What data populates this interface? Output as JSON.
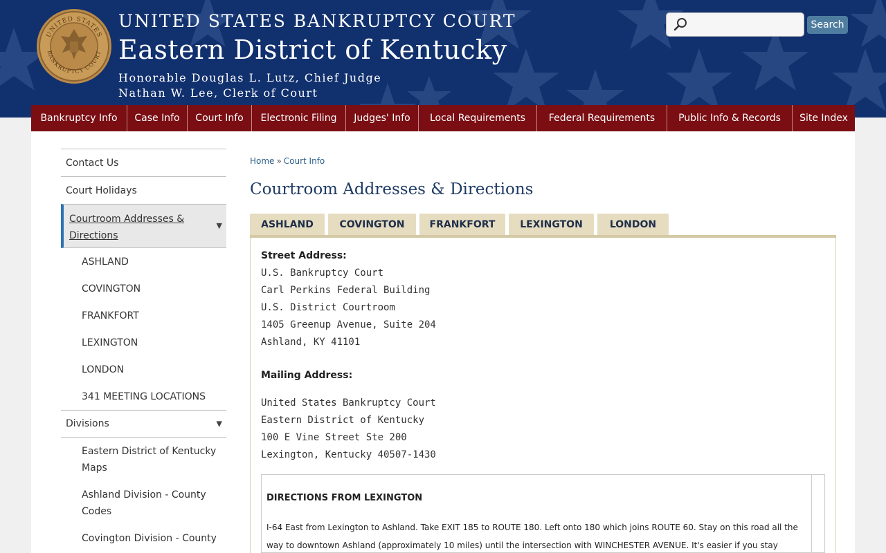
{
  "header": {
    "title_top": "UNITED STATES BANKRUPTCY COURT",
    "title_main": "Eastern District of Kentucky",
    "judge": "Honorable Douglas L. Lutz, Chief Judge",
    "clerk": "Nathan W. Lee, Clerk of Court",
    "seal_top_text": "UNITED STATES",
    "seal_bottom_text": "BANKRUPTCY COURT",
    "search": {
      "button_label": "Search",
      "value": ""
    },
    "colors": {
      "background": "#11306e",
      "nav": "#7a0e13",
      "search_button": "#4f7da0"
    }
  },
  "nav": {
    "items": [
      "Bankruptcy Info",
      "Case Info",
      "Court Info",
      "Electronic Filing",
      "Judges' Info",
      "Local Requirements",
      "Federal Requirements",
      "Public Info & Records",
      "Site Index"
    ]
  },
  "sidebar": {
    "contact": "Contact Us",
    "holidays": "Court Holidays",
    "active": "Courtroom Addresses & Directions",
    "sub": [
      "ASHLAND",
      "COVINGTON",
      "FRANKFORT",
      "LEXINGTON",
      "LONDON",
      "341 MEETING LOCATIONS"
    ],
    "divisions": "Divisions",
    "division_sub": [
      "Eastern District of Kentucky Maps",
      "Ashland Division - County Codes",
      "Covington Division - County"
    ]
  },
  "breadcrumb": {
    "home": "Home",
    "separator": "»",
    "current": "Court Info"
  },
  "page_title": "Courtroom Addresses & Directions",
  "tabs": [
    "ASHLAND",
    "COVINGTON",
    "FRANKFORT",
    "LEXINGTON",
    "LONDON"
  ],
  "content": {
    "street_label": "Street Address:",
    "street_lines": [
      "U.S. Bankruptcy Court",
      "Carl Perkins Federal Building",
      "U.S. District Courtroom",
      "1405 Greenup Avenue, Suite 204",
      "Ashland, KY  41101"
    ],
    "mailing_label": "Mailing Address:",
    "mailing_lines": [
      "United States Bankruptcy Court",
      "Eastern District of Kentucky",
      "100 E Vine Street  Ste 200",
      "Lexington, Kentucky  40507-1430"
    ],
    "directions_title": "DIRECTIONS FROM LEXINGTON",
    "directions_text": "I-64 East from Lexington to Ashland.  Take EXIT 185 to ROUTE 180.  Left onto 180 which joins ROUTE 60.  Stay on this road all the way to downtown Ashland (approximately 10 miles) until the intersection with WINCHESTER AVENUE.  It's easier if you stay"
  }
}
